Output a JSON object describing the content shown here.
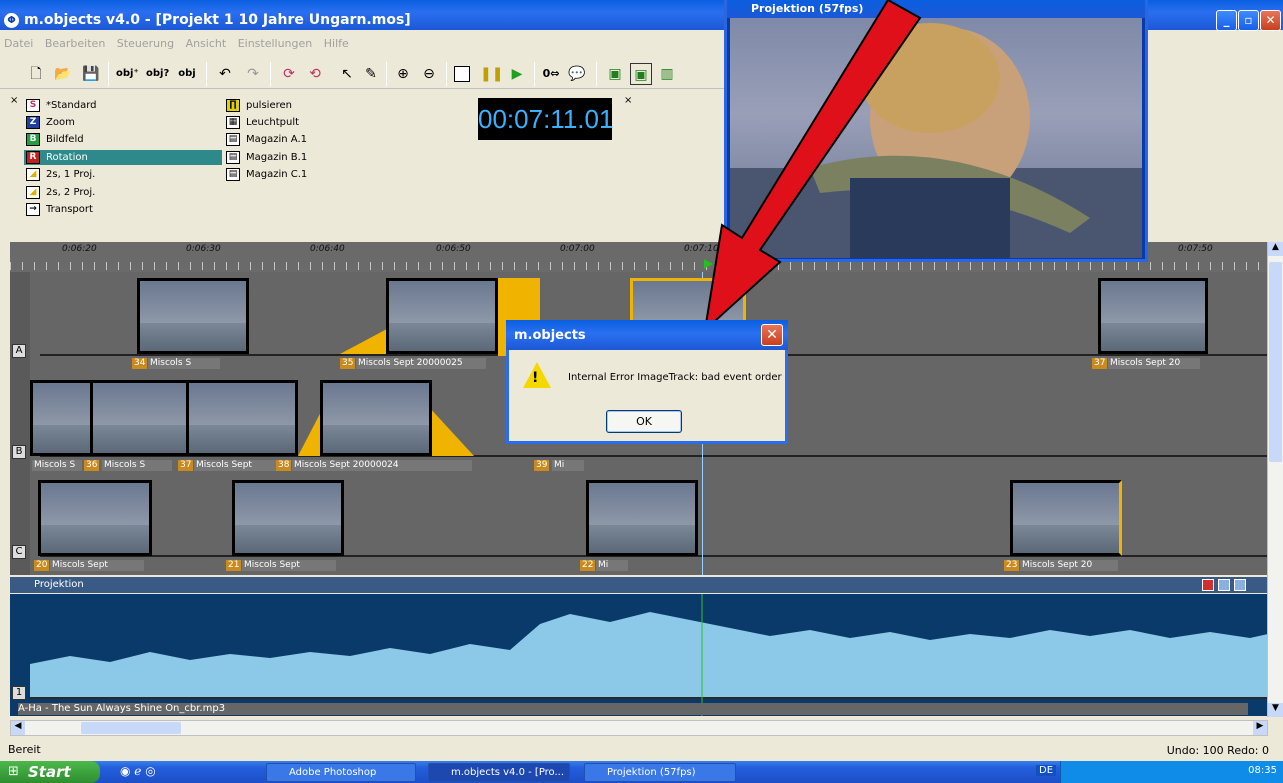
{
  "window": {
    "title": "m.objects v4.0 - [Projekt 1 10 Jahre Ungarn.mos]",
    "icon": "m.objects-icon",
    "min": "_",
    "max": "▫",
    "close": "✕"
  },
  "menu": [
    "Datei",
    "Bearbeiten",
    "Steuerung",
    "Ansicht",
    "Einstellungen",
    "Hilfe"
  ],
  "objects_left": [
    {
      "label": "*Standard",
      "icon": "S"
    },
    {
      "label": "Zoom",
      "icon": "Z"
    },
    {
      "label": "Bildfeld",
      "icon": "B"
    },
    {
      "label": "Rotation",
      "icon": "R"
    },
    {
      "label": "2s, 1 Proj.",
      "icon": "◢"
    },
    {
      "label": "2s, 2 Proj.",
      "icon": "◢"
    },
    {
      "label": "Transport",
      "icon": "→"
    }
  ],
  "objects_right": [
    {
      "label": "pulsieren",
      "icon": "∏"
    },
    {
      "label": "Leuchtpult",
      "icon": "▦"
    },
    {
      "label": "Magazin A.1",
      "icon": "▤"
    },
    {
      "label": "Magazin B.1",
      "icon": "▤"
    },
    {
      "label": "Magazin C.1",
      "icon": "▤"
    }
  ],
  "timecode": "00:07:11.01",
  "ruler_ticks": [
    "0:06:20",
    "0:06:30",
    "0:06:40",
    "0:06:50",
    "0:07:00",
    "0:07:10",
    "0:07:50"
  ],
  "track_labels": [
    "A",
    "B",
    "C",
    "1"
  ],
  "captions": {
    "a34": "34",
    "a34_text": "Miscols S",
    "a35": "35",
    "a35_text": "Miscols Sept 20000025",
    "a37": "37",
    "a37_text": "Miscols Sept 20",
    "b_first": "Miscols S",
    "b36": "36",
    "b36_text": "Miscols S",
    "b37": "37",
    "b37_text": "Miscols Sept",
    "b38": "38",
    "b38_text": "Miscols Sept 20000024",
    "b39": "39",
    "b39_text": "Mi",
    "c20": "20",
    "c20_text": "Miscols Sept",
    "c21": "21",
    "c21_text": "Miscols Sept",
    "c22": "22",
    "c22_text": "Mi",
    "c23": "23",
    "c23_text": "Miscols Sept 20"
  },
  "projection_label": "Projektion",
  "audio_file": "A-Ha - The Sun Always Shine On_cbr.mp3",
  "status": "Bereit",
  "undo_redo": "Undo: 100  Redo: 0",
  "projection_window": {
    "title": "Projektion (57fps)"
  },
  "dialog": {
    "title": "m.objects",
    "message": "Internal Error ImageTrack: bad event order",
    "ok": "OK"
  },
  "taskbar": {
    "start": "Start",
    "tasks": [
      "Adobe Photoshop",
      "m.objects v4.0 - [Pro...",
      "Projektion (57fps)"
    ],
    "lang": "DE",
    "clock": "08:35"
  },
  "colors": {
    "accent": "#2e8a8a",
    "timecode": "#3ab0ff",
    "arrow": "#e0101a",
    "warning": "#f5d800"
  }
}
